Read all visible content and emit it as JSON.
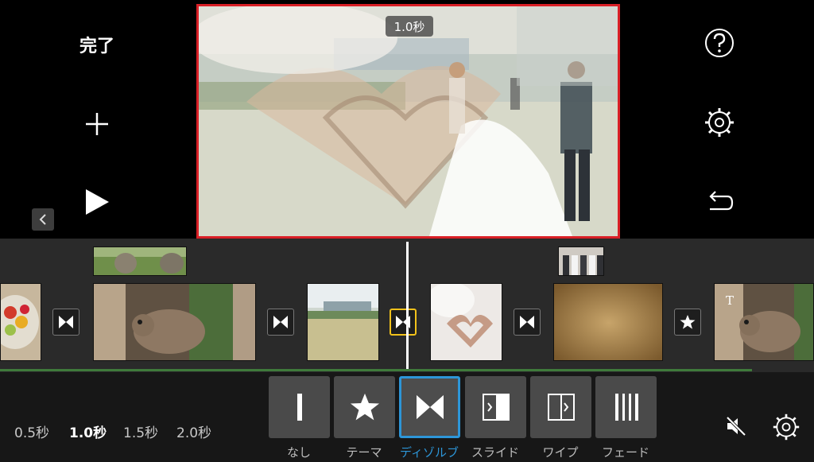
{
  "left_controls": {
    "done_label": "完了"
  },
  "viewer": {
    "duration_badge": "1.0秒"
  },
  "duration_options": [
    {
      "label": "0.5秒",
      "active": false
    },
    {
      "label": "1.0秒",
      "active": true
    },
    {
      "label": "1.5秒",
      "active": false
    },
    {
      "label": "2.0秒",
      "active": false
    }
  ],
  "transition_styles": [
    {
      "label": "なし",
      "icon": "bar-icon",
      "active": false
    },
    {
      "label": "テーマ",
      "icon": "star-icon",
      "active": false
    },
    {
      "label": "ディゾルブ",
      "icon": "bowtie-icon",
      "active": true
    },
    {
      "label": "スライド",
      "icon": "slide-icon",
      "active": false
    },
    {
      "label": "ワイプ",
      "icon": "wipe-icon",
      "active": false
    },
    {
      "label": "フェード",
      "icon": "fade-icon",
      "active": false
    }
  ],
  "colors": {
    "selection_border": "#d91f26",
    "selected_transition": "#f2c21b",
    "active_style": "#2d96d8",
    "track_green": "#3f7a3b"
  }
}
